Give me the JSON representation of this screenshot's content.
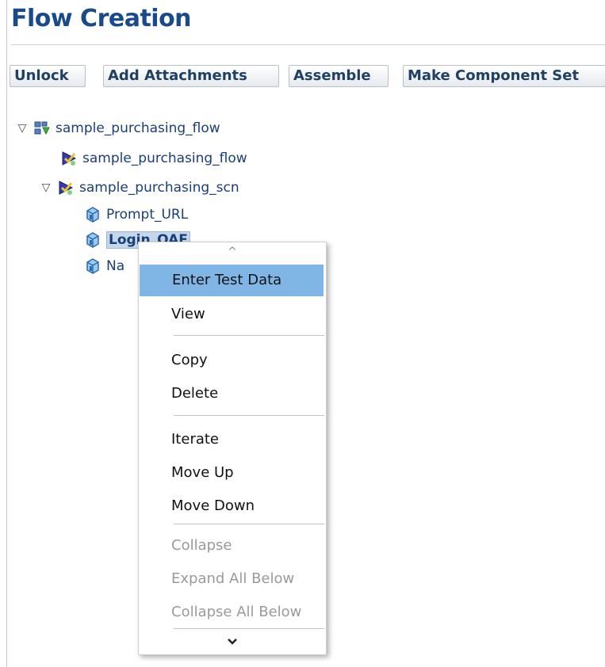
{
  "page": {
    "title": "Flow Creation"
  },
  "toolbar": {
    "unlock": "Unlock",
    "add_attachments": "Add Attachments",
    "assemble": "Assemble",
    "make_component_set": "Make Component Set"
  },
  "tree": {
    "root": "sample_purchasing_flow",
    "flow_child": "sample_purchasing_flow",
    "scn": "sample_purchasing_scn",
    "comp1": "Prompt_URL",
    "comp2": "Login_OAF",
    "comp3": "Na"
  },
  "context_menu": {
    "items": [
      "Enter Test Data",
      "View",
      "Copy",
      "Delete",
      "Iterate",
      "Move Up",
      "Move Down",
      "Collapse",
      "Expand All Below",
      "Collapse All Below"
    ],
    "highlighted_item": "Enter Test Data",
    "disabled_items": [
      "Collapse",
      "Expand All Below",
      "Collapse All Below"
    ]
  },
  "icons": {
    "expanded_twisty": "expanded-triangle-icon",
    "flow": "flow-icon",
    "scenario": "scenario-icon",
    "component": "component-icon",
    "scroll_up": "chevron-up-icon",
    "scroll_down": "chevron-down-icon"
  },
  "colors": {
    "title": "#184a8c",
    "link_text": "#1a3f78",
    "menu_highlight": "#7fb6e6",
    "disabled_text": "#9a9a9a"
  }
}
